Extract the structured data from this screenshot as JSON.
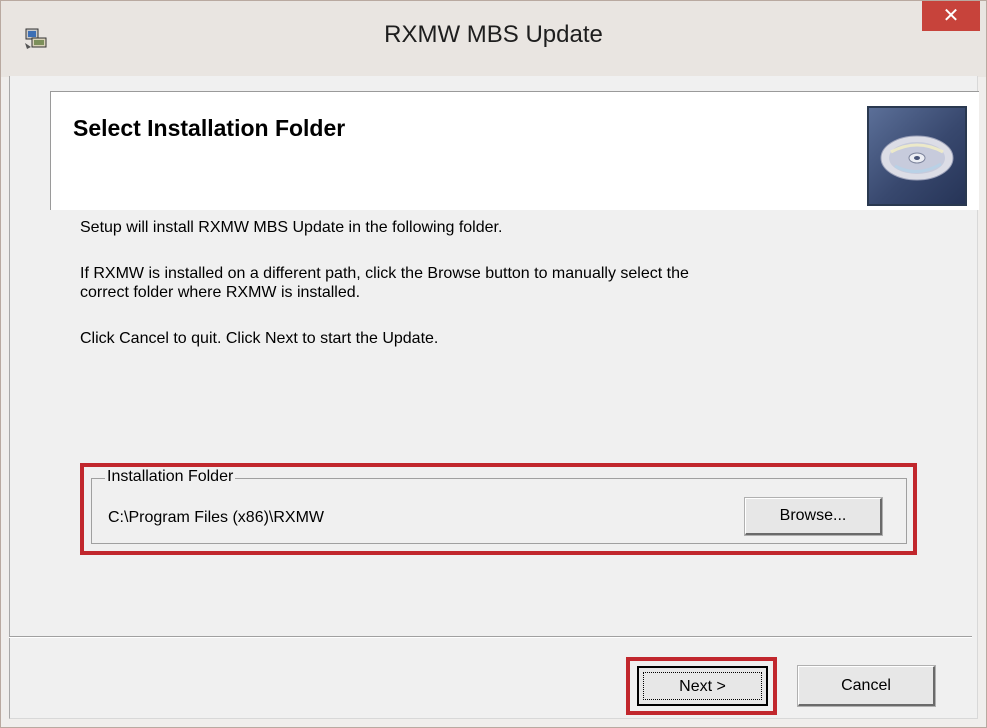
{
  "window": {
    "title": "RXMW MBS Update",
    "close_label": "✕"
  },
  "header": {
    "title": "Select Installation Folder"
  },
  "body": {
    "line1": "Setup will install RXMW MBS Update in the following folder.",
    "line2a": "If RXMW is installed on a different path, click the Browse button to manually select the",
    "line2b": "correct folder where RXMW is installed.",
    "line3": "Click Cancel to quit.  Click Next to start the Update."
  },
  "folder_group": {
    "legend": "Installation Folder",
    "path": "C:\\Program Files (x86)\\RXMW",
    "browse_label": "Browse..."
  },
  "footer": {
    "next_label": "Next >",
    "cancel_label": "Cancel"
  },
  "colors": {
    "highlight": "#c1272d",
    "close_button": "#c7433b"
  }
}
